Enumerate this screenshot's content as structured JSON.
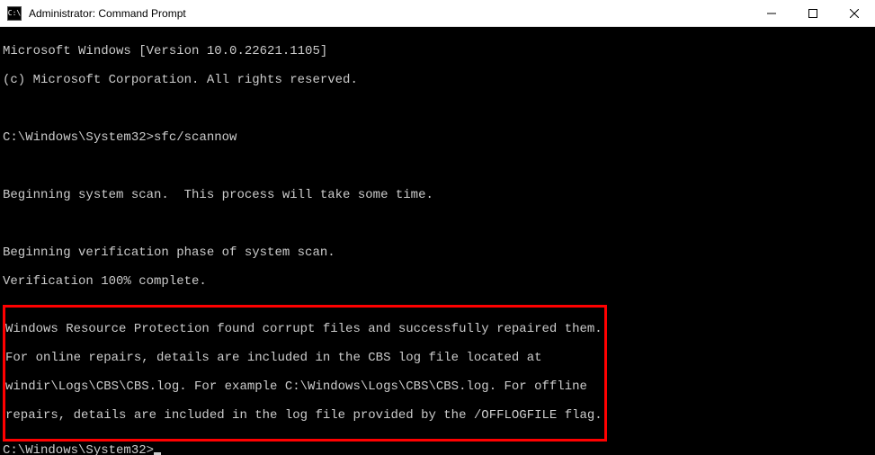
{
  "window": {
    "title": "Administrator: Command Prompt"
  },
  "terminal": {
    "header1": "Microsoft Windows [Version 10.0.22621.1105]",
    "header2": "(c) Microsoft Corporation. All rights reserved.",
    "prompt1_path": "C:\\Windows\\System32>",
    "prompt1_cmd": "sfc/scannow",
    "msg1": "Beginning system scan.  This process will take some time.",
    "msg2": "Beginning verification phase of system scan.",
    "msg3": "Verification 100% complete.",
    "result1": "Windows Resource Protection found corrupt files and successfully repaired them.",
    "result2": "For online repairs, details are included in the CBS log file located at",
    "result3": "windir\\Logs\\CBS\\CBS.log. For example C:\\Windows\\Logs\\CBS\\CBS.log. For offline",
    "result4": "repairs, details are included in the log file provided by the /OFFLOGFILE flag.",
    "prompt2_path": "C:\\Windows\\System32>"
  }
}
